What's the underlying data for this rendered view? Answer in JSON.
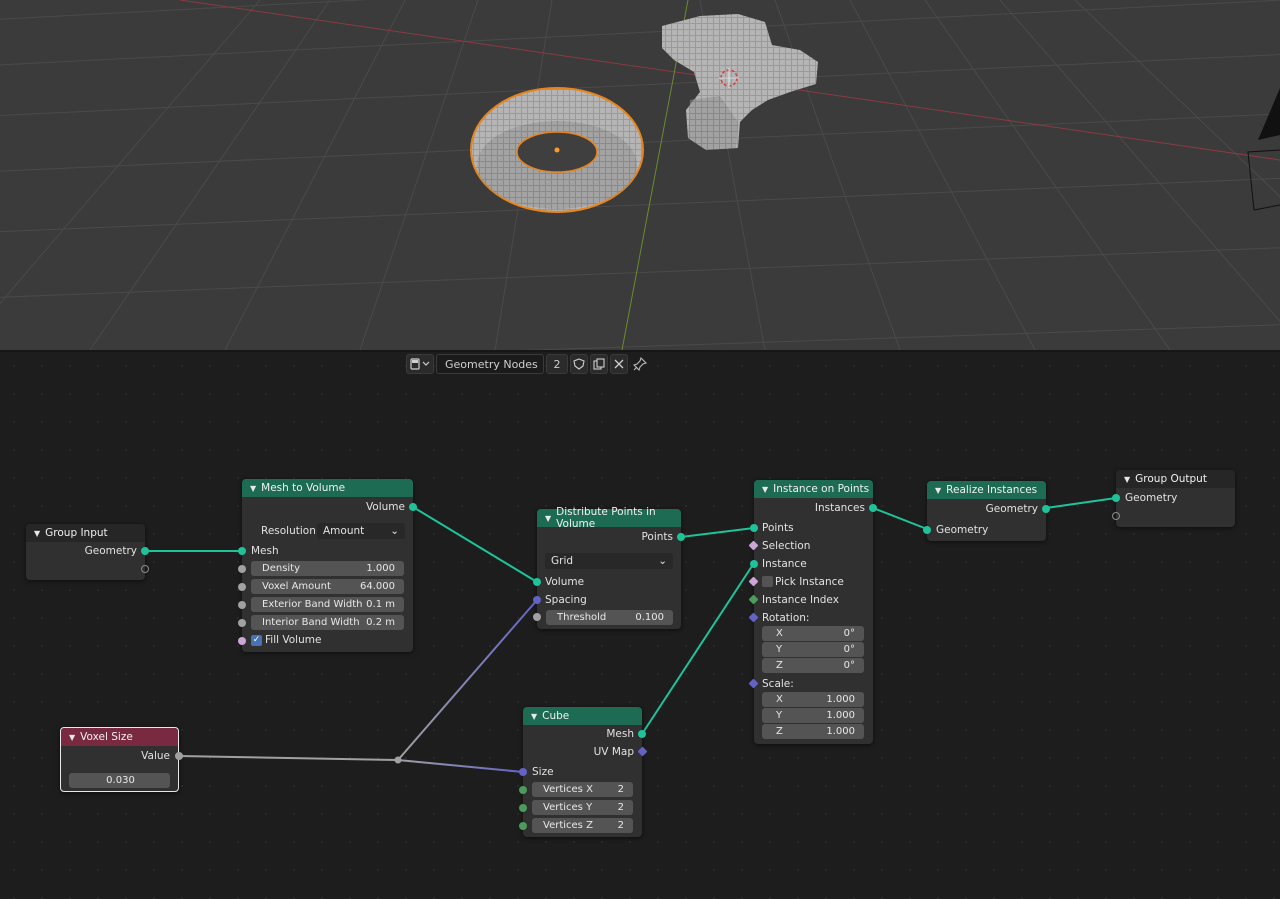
{
  "editor_header": {
    "editor_type_icon": "node-editor-icon",
    "tree_name": "Geometry Nodes",
    "user_count": "2"
  },
  "nodes": {
    "group_input": {
      "title": "Group Input",
      "geometry": "Geometry"
    },
    "mesh_to_volume": {
      "title": "Mesh to Volume",
      "volume": "Volume",
      "resolution_label": "Resolution",
      "resolution_value": "Amount",
      "mesh": "Mesh",
      "density_label": "Density",
      "density_value": "1.000",
      "voxel_amount_label": "Voxel Amount",
      "voxel_amount_value": "64.000",
      "exterior_label": "Exterior Band Width",
      "exterior_value": "0.1 m",
      "interior_label": "Interior Band Width",
      "interior_value": "0.2 m",
      "fill_volume": "Fill Volume"
    },
    "distribute": {
      "title": "Distribute Points in Volume",
      "points": "Points",
      "mode": "Grid",
      "volume": "Volume",
      "spacing": "Spacing",
      "threshold_label": "Threshold",
      "threshold_value": "0.100"
    },
    "instance_on_points": {
      "title": "Instance on Points",
      "instances": "Instances",
      "points": "Points",
      "selection": "Selection",
      "instance": "Instance",
      "pick_instance": "Pick Instance",
      "instance_index": "Instance Index",
      "rotation": "Rotation:",
      "rot_x_label": "X",
      "rot_x_value": "0°",
      "rot_y_label": "Y",
      "rot_y_value": "0°",
      "rot_z_label": "Z",
      "rot_z_value": "0°",
      "scale": "Scale:",
      "scale_x_label": "X",
      "scale_x_value": "1.000",
      "scale_y_label": "Y",
      "scale_y_value": "1.000",
      "scale_z_label": "Z",
      "scale_z_value": "1.000"
    },
    "realize_instances": {
      "title": "Realize Instances",
      "geometry_out": "Geometry",
      "geometry_in": "Geometry"
    },
    "group_output": {
      "title": "Group Output",
      "geometry": "Geometry"
    },
    "voxel_size": {
      "title": "Voxel Size",
      "value_label": "Value",
      "value": "0.030"
    },
    "cube": {
      "title": "Cube",
      "mesh": "Mesh",
      "uv_map": "UV Map",
      "size": "Size",
      "vx_label": "Vertices X",
      "vx_value": "2",
      "vy_label": "Vertices Y",
      "vy_value": "2",
      "vz_label": "Vertices Z",
      "vz_value": "2"
    }
  },
  "colors": {
    "geometry_header": "#1d6b52",
    "input_header": "#7a2a40",
    "geometry_socket": "#1ec39a",
    "vector_socket": "#6363c7",
    "viewport_bg": "#3b3b3b",
    "selection_outline": "#e8841a"
  }
}
